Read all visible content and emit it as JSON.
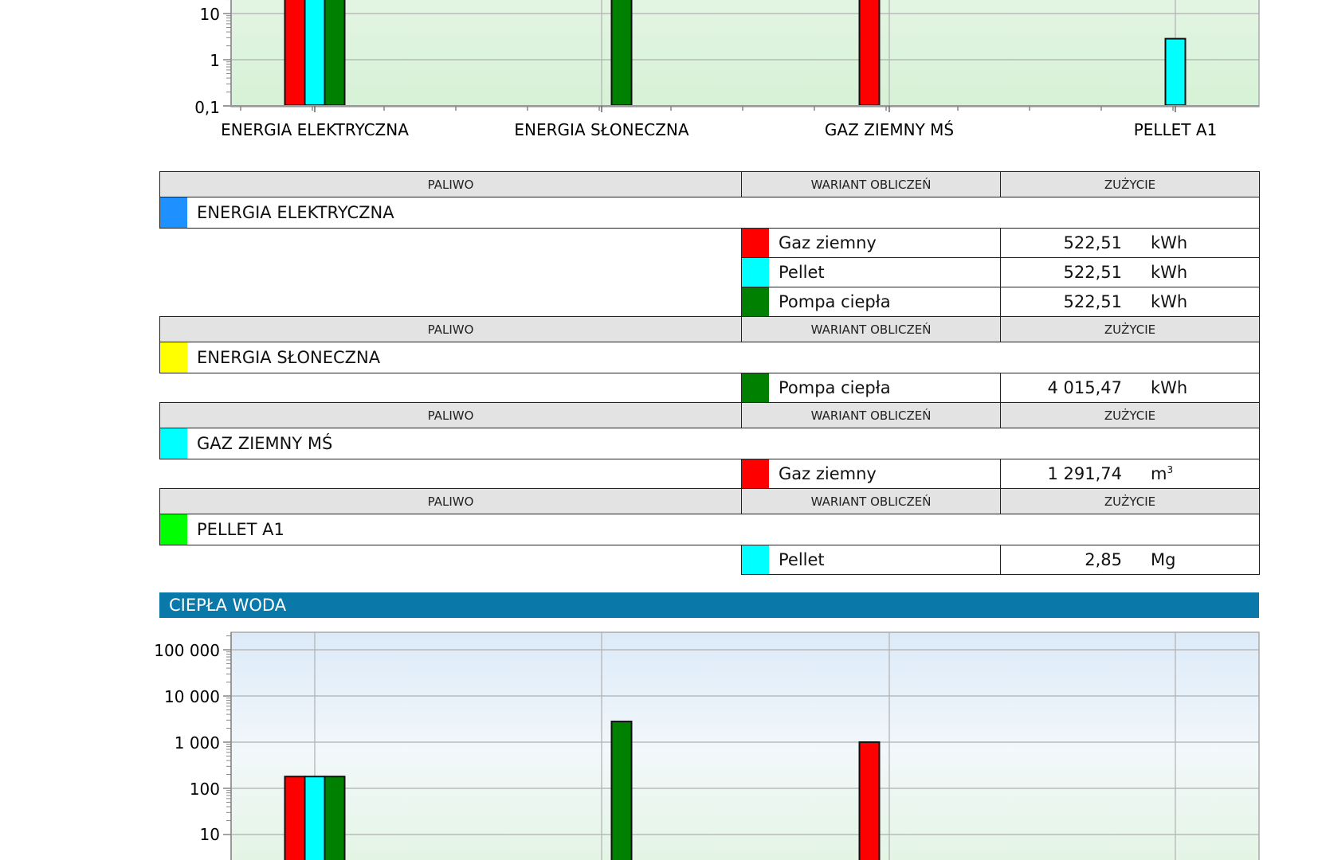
{
  "charts": [
    {
      "ticks": [
        "10",
        "1",
        "0,1"
      ],
      "categories": [
        "ENERGIA ELEKTRYCZNA",
        "ENERGIA SŁONECZNA",
        "GAZ ZIEMNY MŚ",
        "PELLET A1"
      ]
    },
    {
      "ticks": [
        "100 000",
        "10 000",
        "1 000",
        "100",
        "10"
      ]
    }
  ],
  "table": {
    "headers": {
      "paliwo": "PALIWO",
      "wariant": "WARIANT OBLICZEŃ",
      "zuzycie": "ZUŻYCIE"
    },
    "groups": [
      {
        "fuel": "ENERGIA ELEKTRYCZNA",
        "color": "#1e90ff",
        "rows": [
          {
            "variant": "Gaz ziemny",
            "color": "#ff0000",
            "value": "522,51",
            "unit": "kWh",
            "unit_sup": ""
          },
          {
            "variant": "Pellet",
            "color": "#00ffff",
            "value": "522,51",
            "unit": "kWh",
            "unit_sup": ""
          },
          {
            "variant": "Pompa ciepła",
            "color": "#008000",
            "value": "522,51",
            "unit": "kWh",
            "unit_sup": ""
          }
        ]
      },
      {
        "fuel": "ENERGIA SŁONECZNA",
        "color": "#ffff00",
        "rows": [
          {
            "variant": "Pompa ciepła",
            "color": "#008000",
            "value": "4 015,47",
            "unit": "kWh",
            "unit_sup": ""
          }
        ]
      },
      {
        "fuel": "GAZ ZIEMNY MŚ",
        "color": "#00ffff",
        "rows": [
          {
            "variant": "Gaz ziemny",
            "color": "#ff0000",
            "value": "1 291,74",
            "unit": "m",
            "unit_sup": "3"
          }
        ]
      },
      {
        "fuel": "PELLET A1",
        "color": "#00ff00",
        "rows": [
          {
            "variant": "Pellet",
            "color": "#00ffff",
            "value": "2,85",
            "unit": "Mg",
            "unit_sup": ""
          }
        ]
      }
    ]
  },
  "section": {
    "title": "CIEPŁA WODA"
  },
  "chart_data": [
    {
      "type": "bar",
      "scale": "log",
      "title": "",
      "xlabel": "",
      "ylabel": "",
      "ylim_visible": [
        0.1,
        20
      ],
      "categories": [
        "ENERGIA ELEKTRYCZNA",
        "ENERGIA SŁONECZNA",
        "GAZ ZIEMNY MŚ",
        "PELLET A1"
      ],
      "series": [
        {
          "color": "#ff0000",
          "values": [
            522.51,
            null,
            1291.74,
            null
          ]
        },
        {
          "color": "#00ffff",
          "values": [
            522.51,
            null,
            null,
            2.85
          ]
        },
        {
          "color": "#008000",
          "values": [
            522.51,
            4015.47,
            null,
            null
          ]
        }
      ],
      "grid": true
    },
    {
      "type": "bar",
      "scale": "log",
      "title": "",
      "xlabel": "",
      "ylabel": "",
      "ylim_visible": [
        3,
        100000
      ],
      "categories": [
        "ENERGIA ELEKTRYCZNA",
        "ENERGIA SŁONECZNA",
        "GAZ ZIEMNY MŚ",
        "PELLET A1"
      ],
      "series": [
        {
          "color": "#ff0000",
          "values": [
            180,
            null,
            1000,
            null
          ]
        },
        {
          "color": "#00ffff",
          "values": [
            180,
            null,
            null,
            null
          ]
        },
        {
          "color": "#008000",
          "values": [
            180,
            2800,
            null,
            null
          ]
        }
      ],
      "grid": true
    }
  ]
}
